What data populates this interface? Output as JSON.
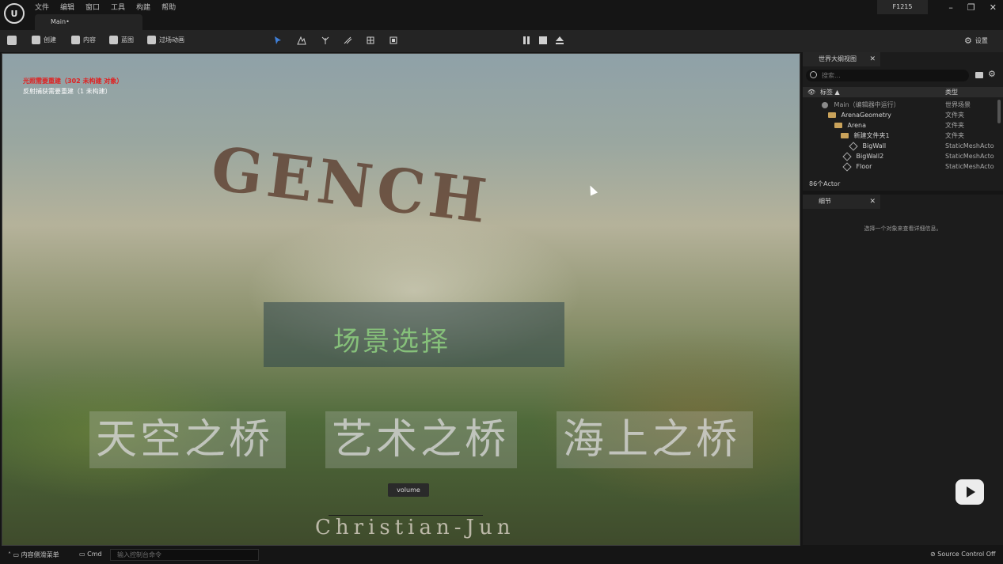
{
  "app": {
    "logo": "U",
    "menu": [
      "文件",
      "编辑",
      "窗口",
      "工具",
      "构建",
      "帮助"
    ],
    "doc_tab": "Main•",
    "project": "F1215",
    "window_controls": [
      "minimize-icon",
      "restore-icon",
      "close-icon"
    ]
  },
  "toolbar": {
    "save_icon": "save-icon",
    "create_label": "创建",
    "content_label": "内容",
    "blueprint_label": "蓝图",
    "cinematics_label": "过场动画",
    "settings_label": "设置",
    "mode_icons": [
      "select-mode-icon",
      "landscape-mode-icon",
      "foliage-mode-icon",
      "mesh-paint-icon",
      "fracture-icon",
      "brush-edit-icon"
    ],
    "play_controls": [
      "pause-icon",
      "stop-icon",
      "eject-icon"
    ]
  },
  "viewport": {
    "warning_lighting": "光照需要重建（302 未构建 对象）",
    "warning_reflection": "反射捕获需要重建（1 未构建）",
    "logo_text": "GENCH",
    "scene_title": "场景选择",
    "bridges": [
      "天空之桥",
      "艺术之桥",
      "海上之桥"
    ],
    "volume_label": "volume",
    "author": "Christian-Jun"
  },
  "outliner": {
    "tab_label": "世界大纲视图",
    "search_placeholder": "搜索...",
    "col_label": "标签 ▲",
    "col_type": "类型",
    "rows": [
      {
        "name": "Main（编辑器中运行）",
        "type": "世界场景"
      },
      {
        "name": "ArenaGeometry",
        "type": "文件夹"
      },
      {
        "name": "Arena",
        "type": "文件夹"
      },
      {
        "name": "新建文件夹1",
        "type": "文件夹"
      },
      {
        "name": "BigWall",
        "type": "StaticMeshActo"
      },
      {
        "name": "BigWall2",
        "type": "StaticMeshActo"
      },
      {
        "name": "Floor",
        "type": "StaticMeshActo"
      }
    ],
    "actor_count": "86个Actor"
  },
  "details": {
    "tab_label": "细节",
    "hint": "选择一个对象来查看详细信息。"
  },
  "statusbar": {
    "content_drawer": "内容侧滑菜单",
    "cmd_label": "Cmd",
    "cmd_placeholder": "输入控制台命令",
    "source_control": "Source Control Off"
  },
  "colors": {
    "warning_red": "#e02020",
    "scene_title_green": "#86c07a",
    "select_blue": "#3f7fd8"
  }
}
